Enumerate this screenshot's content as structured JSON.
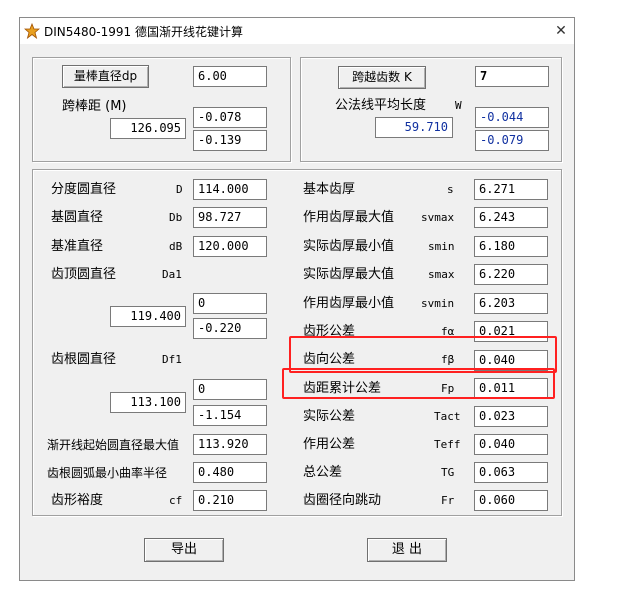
{
  "window": {
    "title": "DIN5480-1991 德国渐开线花键计算",
    "close_glyph": "✕"
  },
  "top_left": {
    "dp_button": "量棒直径dp",
    "dp_value": "6.00",
    "span_label": "跨棒距 (M)",
    "span_value": "126.095",
    "span_dev_upper": "-0.078",
    "span_dev_lower": "-0.139"
  },
  "top_right": {
    "k_button": "跨越齿数 K",
    "k_value": "7",
    "w_label": "公法线平均长度",
    "w_symbol": "W",
    "w_value": "59.710",
    "w_dev_upper": "-0.044",
    "w_dev_lower": "-0.079"
  },
  "left_rows": {
    "D": {
      "label": "分度圆直径",
      "symbol": "D",
      "value": "114.000"
    },
    "Db": {
      "label": "基圆直径",
      "symbol": "Db",
      "value": "98.727"
    },
    "dB": {
      "label": "基准直径",
      "symbol": "dB",
      "value": "120.000"
    },
    "Da1": {
      "label": "齿顶圆直径",
      "symbol": "Da1",
      "value": "119.400",
      "dev_upper": "0",
      "dev_lower": "-0.220"
    },
    "Df1": {
      "label": "齿根圆直径",
      "symbol": "Df1",
      "value": "113.100",
      "dev_upper": "0",
      "dev_lower": "-1.154"
    },
    "involute_start": {
      "label": "渐开线起始圆直径最大值",
      "value": "113.920"
    },
    "root_radius": {
      "label": "齿根圆弧最小曲率半径",
      "value": "0.480"
    },
    "cf": {
      "label": "齿形裕度",
      "symbol": "cf",
      "value": "0.210"
    }
  },
  "right_rows": [
    {
      "label": "基本齿厚",
      "symbol": "s",
      "value": "6.271"
    },
    {
      "label": "作用齿厚最大值",
      "symbol": "svmax",
      "value": "6.243"
    },
    {
      "label": "实际齿厚最小值",
      "symbol": "smin",
      "value": "6.180"
    },
    {
      "label": "实际齿厚最大值",
      "symbol": "smax",
      "value": "6.220"
    },
    {
      "label": "作用齿厚最小值",
      "symbol": "svmin",
      "value": "6.203"
    },
    {
      "label": "齿形公差",
      "symbol": "fα",
      "value": "0.021"
    },
    {
      "label": "齿向公差",
      "symbol": "fβ",
      "value": "0.040"
    },
    {
      "label": "齿距累计公差",
      "symbol": "Fp",
      "value": "0.011"
    },
    {
      "label": "实际公差",
      "symbol": "Tact",
      "value": "0.023"
    },
    {
      "label": "作用公差",
      "symbol": "Teff",
      "value": "0.040"
    },
    {
      "label": "总公差",
      "symbol": "TG",
      "value": "0.063"
    },
    {
      "label": "齿圈径向跳动",
      "symbol": "Fr",
      "value": "0.060"
    }
  ],
  "bottom": {
    "export_button": "导出",
    "exit_button": "退 出"
  },
  "colors": {
    "highlight": "#ff2020",
    "deviation_text": "#1030a0"
  }
}
